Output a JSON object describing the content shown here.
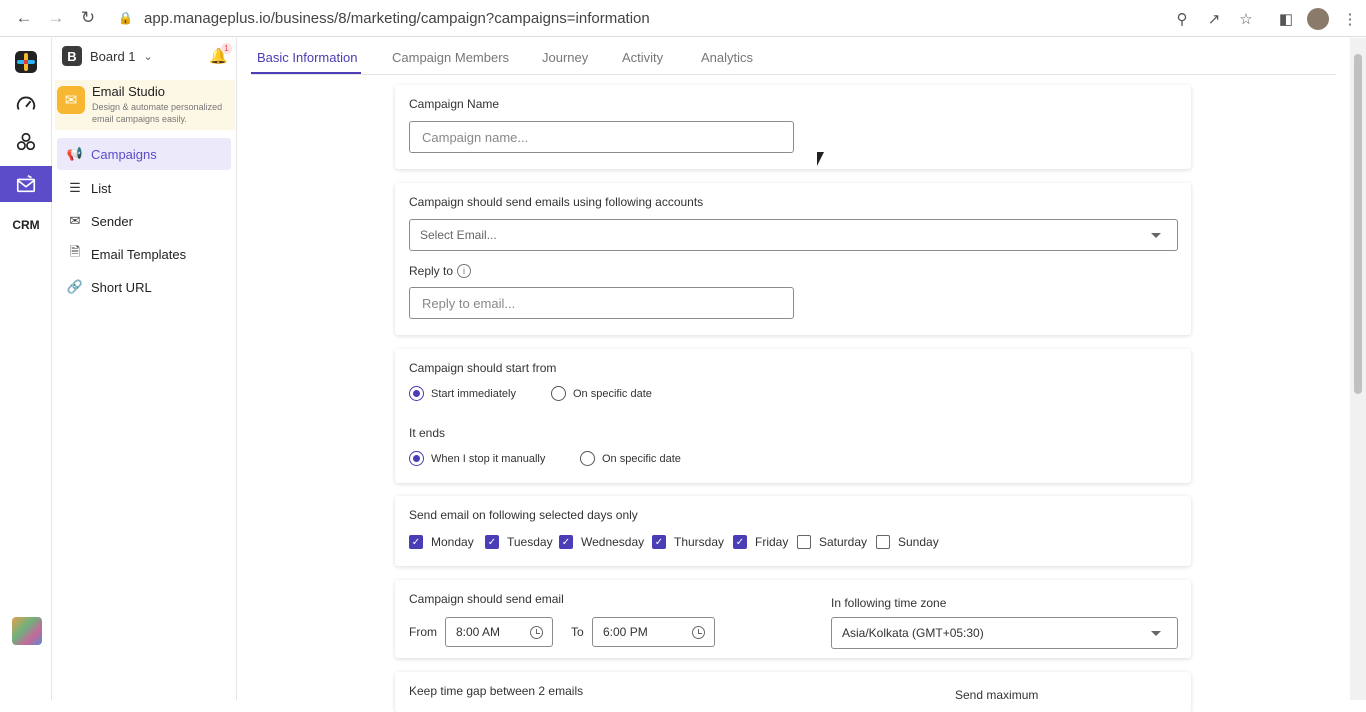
{
  "browser": {
    "url": "app.manageplus.io/business/8/marketing/campaign?campaigns=information"
  },
  "sidebar": {
    "board_initial": "B",
    "board_name": "Board 1",
    "notification_count": "1",
    "studio_title": "Email Studio",
    "studio_desc_1": "Design & automate personalized",
    "studio_desc_2": "email campaigns easily.",
    "items": [
      {
        "label": "Campaigns",
        "icon": "megaphone-icon"
      },
      {
        "label": "List",
        "icon": "list-icon"
      },
      {
        "label": "Sender",
        "icon": "sender-icon"
      },
      {
        "label": "Email Templates",
        "icon": "document-icon"
      },
      {
        "label": "Short URL",
        "icon": "link-icon"
      }
    ]
  },
  "tabs": [
    "Basic Information",
    "Campaign Members",
    "Journey",
    "Activity",
    "Analytics"
  ],
  "form": {
    "campaign_name_label": "Campaign Name",
    "campaign_name_placeholder": "Campaign name...",
    "accounts_label": "Campaign should send emails using following accounts",
    "select_email_placeholder": "Select Email...",
    "reply_to_label": "Reply to",
    "reply_to_placeholder": "Reply to email...",
    "start_label": "Campaign should start from",
    "start_immediately": "Start immediately",
    "start_specific": "On specific date",
    "ends_label": "It ends",
    "ends_manually": "When I stop it manually",
    "ends_specific": "On specific date",
    "days_label": "Send email on following selected days only",
    "days": [
      {
        "name": "Monday",
        "checked": true
      },
      {
        "name": "Tuesday",
        "checked": true
      },
      {
        "name": "Wednesday",
        "checked": true
      },
      {
        "name": "Thursday",
        "checked": true
      },
      {
        "name": "Friday",
        "checked": true
      },
      {
        "name": "Saturday",
        "checked": false
      },
      {
        "name": "Sunday",
        "checked": false
      }
    ],
    "send_label": "Campaign should send email",
    "from_label": "From",
    "from_value": "8:00 AM",
    "to_label": "To",
    "to_value": "6:00 PM",
    "timezone_label": "In following time zone",
    "timezone_value": "Asia/Kolkata (GMT+05:30)",
    "gap_label": "Keep time gap between 2 emails",
    "send_max_label": "Send maximum"
  },
  "colors": {
    "accent": "#4a3db5",
    "studio_bg": "#fdf7e6",
    "studio_icon": "#f7b731"
  }
}
